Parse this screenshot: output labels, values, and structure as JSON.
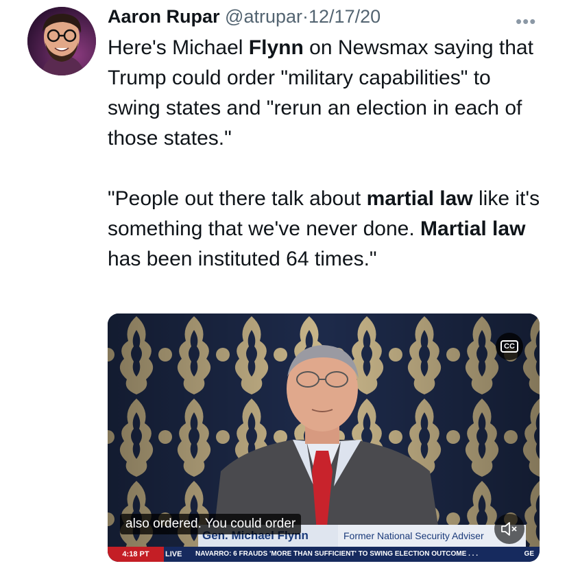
{
  "tweet": {
    "author_name": "Aaron Rupar",
    "handle": "@atrupar",
    "separator": "·",
    "date": "12/17/20",
    "more_label": "•••",
    "text_runs": [
      {
        "t": "Here's Michael ",
        "b": false
      },
      {
        "t": "Flynn",
        "b": true
      },
      {
        "t": " on Newsmax saying that Trump could order \"military capabilities\" to swing states and \"rerun an election in each of those states.\"\n\n\"People out there talk about ",
        "b": false
      },
      {
        "t": "martial law",
        "b": true
      },
      {
        "t": " like it's something that we've never done. ",
        "b": false
      },
      {
        "t": "Martial law",
        "b": true
      },
      {
        "t": " has been instituted 64 times.\"",
        "b": false
      }
    ]
  },
  "video": {
    "caption_text": "also ordered. You could order",
    "cc_label": "CC",
    "lower_third_name": "Gen. Michael Flynn",
    "lower_third_title": "Former National Security Adviser",
    "ticker_time": "4:18 PT",
    "ticker_live": "LIVE",
    "ticker_text": "NAVARRO: 6 FRAUDS 'MORE THAN SUFFICIENT' TO SWING ELECTION OUTCOME . . .",
    "ticker_end": "GE",
    "mute_icon": "speaker-muted-icon",
    "colors": {
      "curtain_dark": "#1d2a4a",
      "damask_gold": "#c9b68a",
      "suit": "#4a4a4e",
      "tie": "#c8232c",
      "ticker_red": "#c41e25",
      "ticker_navy": "#162a5e"
    }
  },
  "colors": {
    "text_primary": "#0f1419",
    "text_secondary": "#536471"
  }
}
